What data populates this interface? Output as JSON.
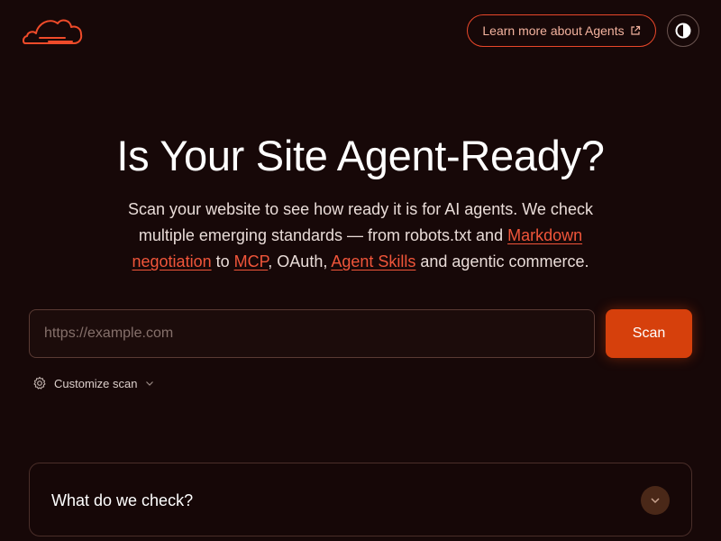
{
  "header": {
    "logo": "cloudflare-cloud-logo",
    "learn_more_label": "Learn more about Agents",
    "learn_more_icon": "external-link-icon",
    "theme_toggle_icon": "contrast-icon"
  },
  "hero": {
    "title": "Is Your Site Agent-Ready?",
    "desc_1": "Scan your website to see how ready it is for AI agents. We check multiple emerging standards — from robots.txt and ",
    "link_markdown": "Markdown negotiation",
    "desc_2": " to ",
    "link_mcp": "MCP",
    "desc_3": ", OAuth, ",
    "link_skills": "Agent Skills",
    "desc_4": " and agentic commerce."
  },
  "scan": {
    "placeholder": "https://example.com",
    "value": "",
    "button_label": "Scan",
    "customize_label": "Customize scan",
    "customize_icon": "gear-icon",
    "customize_chevron": "chevron-down-icon"
  },
  "accordion": {
    "title": "What do we check?",
    "chevron": "chevron-down-icon"
  },
  "colors": {
    "background": "#170808",
    "accent": "#d6400c",
    "link": "#f0553a",
    "chevron_bg": "#4a2818"
  }
}
